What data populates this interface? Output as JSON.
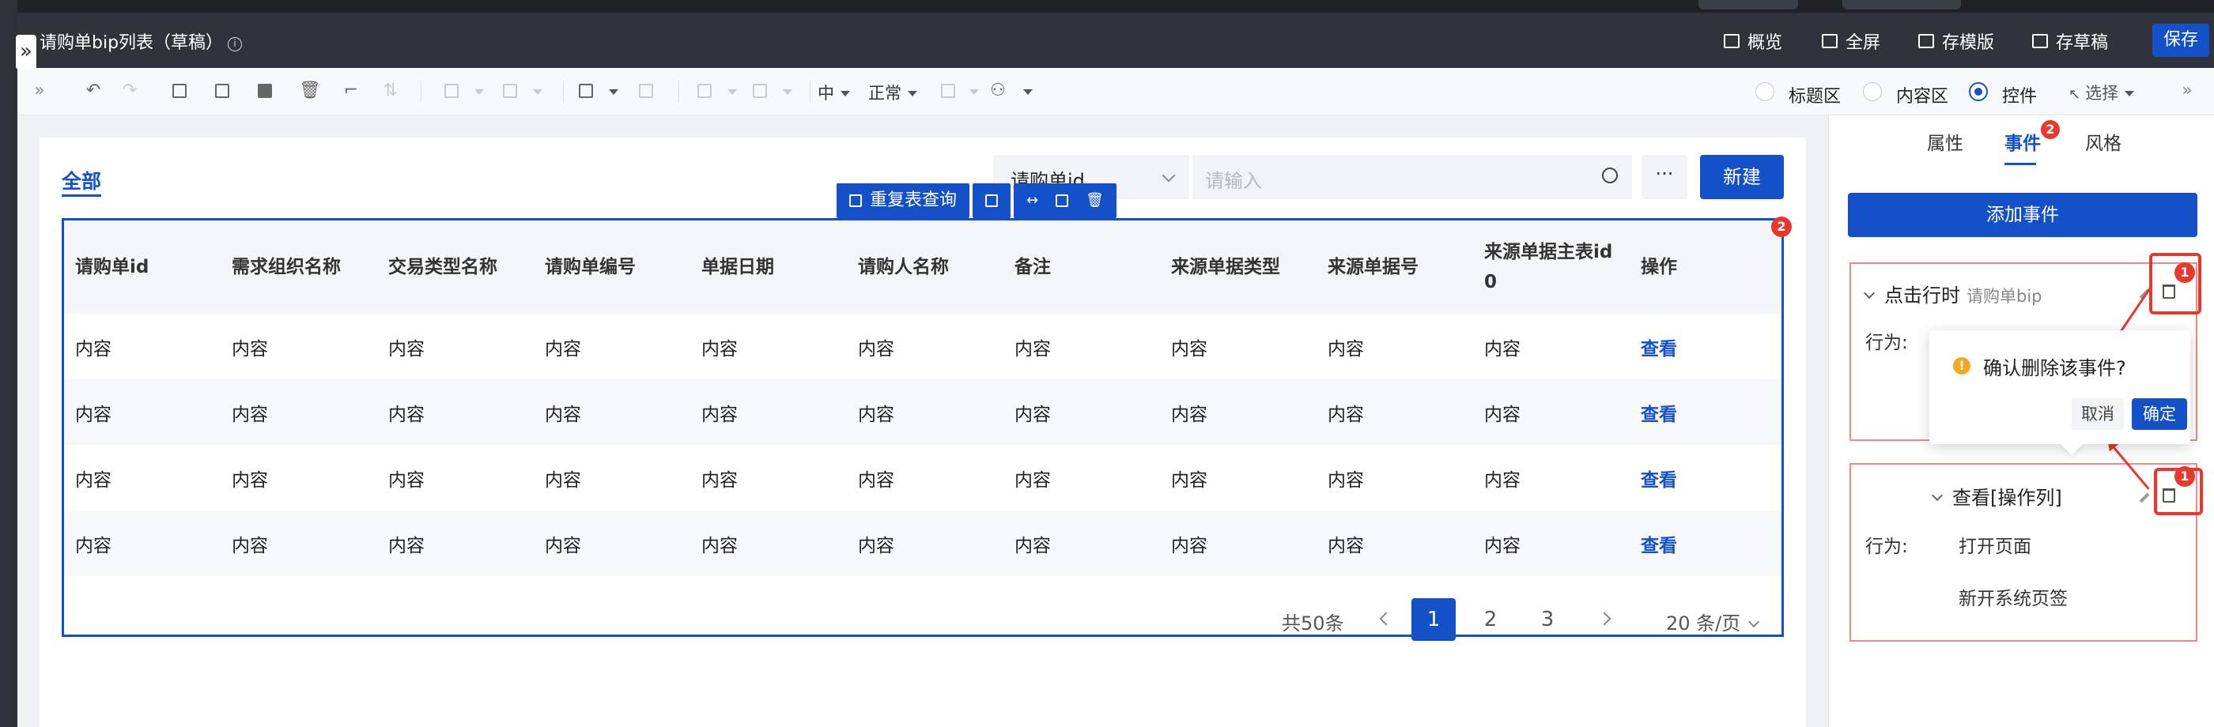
{
  "header": {
    "title": "请购单bip列表（草稿）",
    "info_icon": "info-icon",
    "buttons": [
      "概览",
      "全屏",
      "存模版",
      "存草稿"
    ],
    "save_label": "保存"
  },
  "toolbar": {
    "font_size_label": "中",
    "font_weight_label": "正常",
    "areas": [
      "标题区",
      "内容区",
      "控件"
    ],
    "selected_area": "控件",
    "select_label": "选择"
  },
  "main": {
    "tab_all": "全部",
    "search": {
      "field": "请购单id",
      "placeholder": "请输入"
    },
    "more_label": "···",
    "new_label": "新建",
    "table_toolbar": {
      "requery_label": "重复表查询"
    },
    "table_badge": "2",
    "columns": [
      "请购单id",
      "需求组织名称",
      "交易类型名称",
      "请购单编号",
      "单据日期",
      "请购人名称",
      "备注",
      "来源单据类型",
      "来源单据号",
      "来源单据主表id0",
      "操作"
    ],
    "rows": [
      [
        "内容",
        "内容",
        "内容",
        "内容",
        "内容",
        "内容",
        "内容",
        "内容",
        "内容",
        "内容",
        "查看"
      ],
      [
        "内容",
        "内容",
        "内容",
        "内容",
        "内容",
        "内容",
        "内容",
        "内容",
        "内容",
        "内容",
        "查看"
      ],
      [
        "内容",
        "内容",
        "内容",
        "内容",
        "内容",
        "内容",
        "内容",
        "内容",
        "内容",
        "内容",
        "查看"
      ],
      [
        "内容",
        "内容",
        "内容",
        "内容",
        "内容",
        "内容",
        "内容",
        "内容",
        "内容",
        "内容",
        "查看"
      ]
    ],
    "pager": {
      "total": "共50条",
      "pages": [
        "1",
        "2",
        "3"
      ],
      "current": "1",
      "page_size": "20 条/页"
    }
  },
  "panel": {
    "tabs": [
      "属性",
      "事件",
      "风格"
    ],
    "active_tab": "事件",
    "event_tab_badge": "2",
    "add_event_label": "添加事件",
    "events": [
      {
        "title": "点击行时",
        "subtitle": "请购单bip",
        "action_label": "行为:",
        "actions": []
      },
      {
        "title": "查看[操作列]",
        "subtitle": "",
        "action_label": "行为:",
        "actions": [
          "打开页面",
          "新开系统页签"
        ]
      }
    ],
    "step_badge": "1",
    "popconfirm": {
      "message": "确认删除该事件?",
      "cancel_label": "取消",
      "ok_label": "确定"
    }
  },
  "colors": {
    "primary": "#1451c9",
    "danger": "#e8372c",
    "warning": "#f5a623",
    "header_bg": "#30343a"
  }
}
